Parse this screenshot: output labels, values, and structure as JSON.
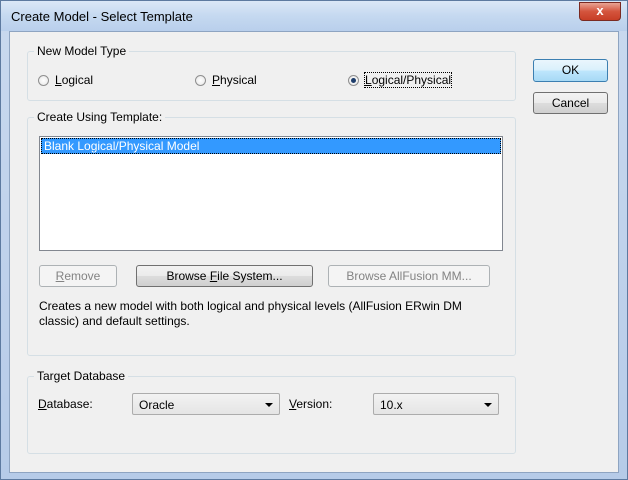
{
  "window": {
    "title": "Create Model - Select Template",
    "close_glyph": "x"
  },
  "model_type": {
    "group_label": "New Model Type",
    "options": [
      {
        "mnemonic": "L",
        "rest": "ogical",
        "checked": false
      },
      {
        "mnemonic": "P",
        "rest": "hysical",
        "checked": false
      },
      {
        "mnemonic": "L",
        "rest": "ogical/Physical",
        "checked": true
      }
    ]
  },
  "buttons": {
    "ok": "OK",
    "cancel": "Cancel",
    "remove_mnemonic": "R",
    "remove_rest": "emove",
    "browse_fs_pre": "Browse ",
    "browse_fs_mnemonic": "F",
    "browse_fs_rest": "ile System...",
    "browse_mm": "Browse AllFusion MM..."
  },
  "template": {
    "group_label": "Create Using Template:",
    "items": [
      "Blank Logical/Physical Model"
    ],
    "selected_index": 0,
    "description": "Creates a new model with both logical and physical levels (AllFusion ERwin DM classic) and default settings."
  },
  "target_db": {
    "group_label": "Target Database",
    "database_label_mnemonic": "D",
    "database_label_rest": "atabase:",
    "database_value": "Oracle",
    "version_label_mnemonic": "V",
    "version_label_rest": "ersion:",
    "version_value": "10.x"
  },
  "icons": {
    "close": "close-icon",
    "dropdown": "chevron-down-icon",
    "radio": "radio-icon"
  },
  "colors": {
    "selection": "#3399ff",
    "close_button": "#c73e26",
    "title_bar": "#c5d9f0"
  }
}
